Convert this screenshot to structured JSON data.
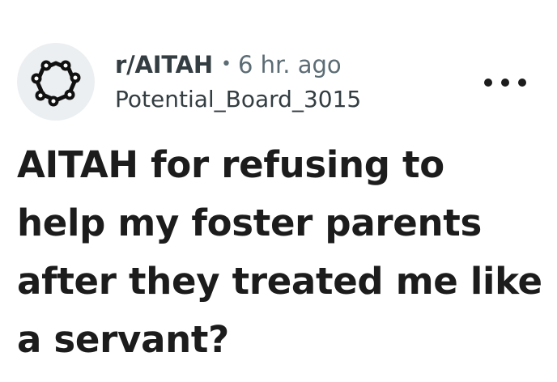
{
  "post": {
    "subreddit": "r/AITAH",
    "separator": "•",
    "time_ago": "6 hr. ago",
    "author": "Potential_Board_3015",
    "title": "AITAH for refusing to help my foster parents after they treated me like a servant?",
    "avatar_icon": "subreddit-ring-icon",
    "more_icon": "more-options-icon"
  },
  "colors": {
    "text_primary": "#1c1c1c",
    "text_meta": "#5c6c74",
    "avatar_bg": "#eceff1"
  }
}
